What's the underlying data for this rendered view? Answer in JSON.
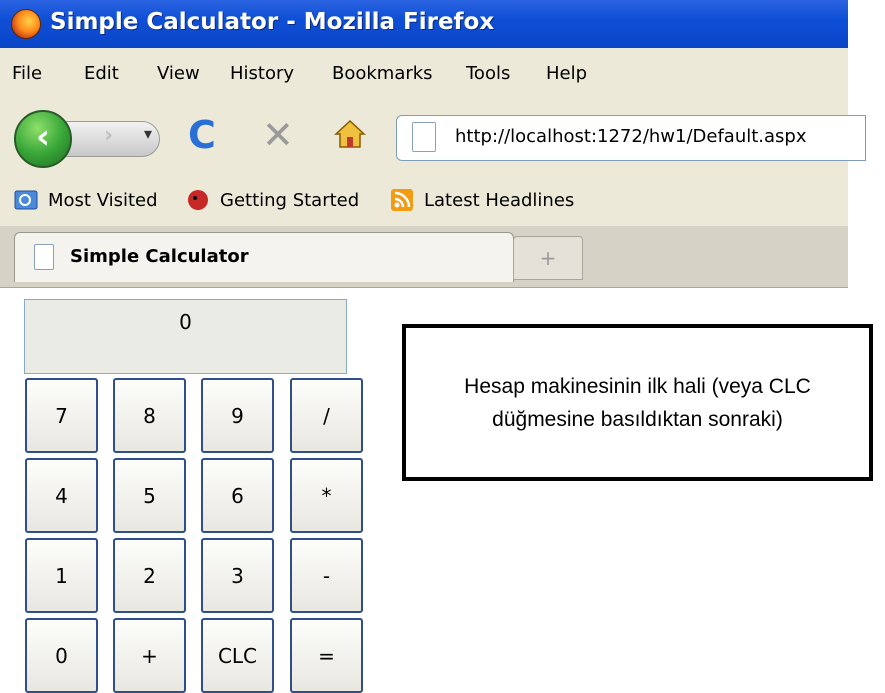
{
  "window": {
    "title": "Simple Calculator - Mozilla Firefox"
  },
  "menu": [
    "File",
    "Edit",
    "View",
    "History",
    "Bookmarks",
    "Tools",
    "Help"
  ],
  "nav": {
    "url": "http://localhost:1272/hw1/Default.aspx"
  },
  "bookmarks": [
    "Most Visited",
    "Getting Started",
    "Latest Headlines"
  ],
  "tabs": {
    "active_label": "Simple Calculator",
    "new_tab_label": "+"
  },
  "calculator": {
    "display": "0",
    "keys": [
      "7",
      "8",
      "9",
      "/",
      "4",
      "5",
      "6",
      "*",
      "1",
      "2",
      "3",
      "-",
      "0",
      "+",
      "CLC",
      "="
    ]
  },
  "note": {
    "text": "Hesap makinesinin ilk hali (veya CLC düğmesine basıldıktan sonraki)"
  }
}
